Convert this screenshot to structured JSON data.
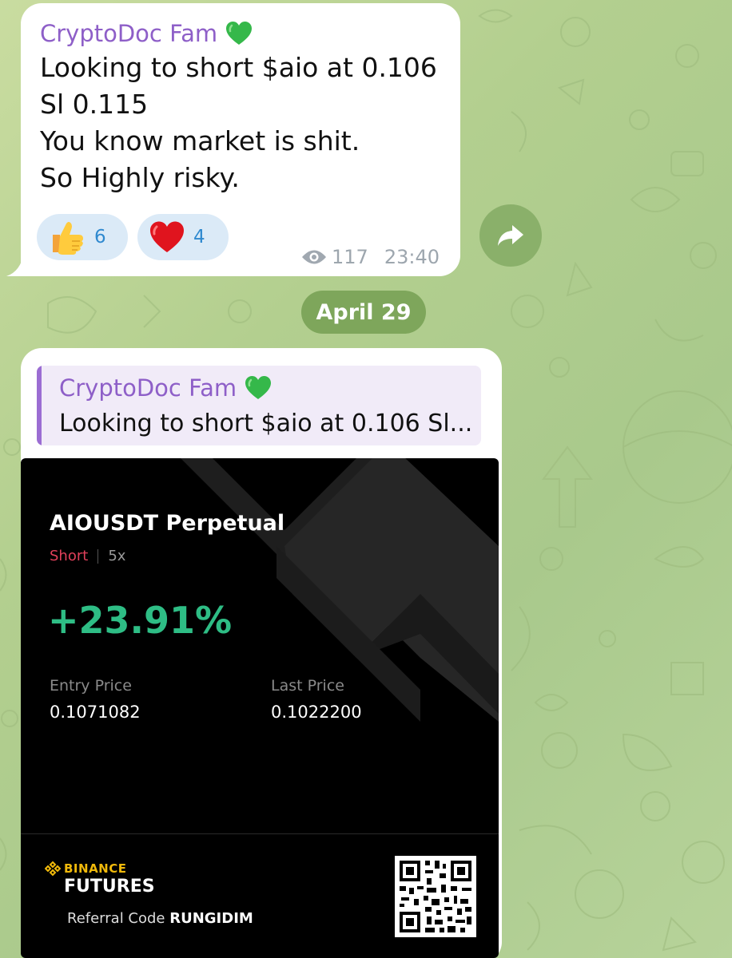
{
  "first_message": {
    "sender": "CryptoDoc Fam",
    "lines": [
      "Looking to short $aio at 0.106",
      "Sl 0.115",
      "You know market is shit.",
      "So Highly risky."
    ],
    "reactions": [
      {
        "emoji": "thumbs-up",
        "count": "6"
      },
      {
        "emoji": "red-heart",
        "count": "4"
      }
    ],
    "views": "117",
    "time": "23:40"
  },
  "date_separator": "April 29",
  "second_message": {
    "reply": {
      "sender": "CryptoDoc Fam",
      "snippet": "Looking to short $aio at 0.106 Sl..."
    },
    "card": {
      "pair": "AIOUSDT Perpetual",
      "side": "Short",
      "leverage": "5x",
      "pnl": "+23.91%",
      "entry_label": "Entry Price",
      "entry_value": "0.1071082",
      "last_label": "Last Price",
      "last_value": "0.1022200",
      "brand_top": "BINANCE",
      "brand_bottom": "FUTURES",
      "referral_label": "Referral Code",
      "referral_code": "RUNGIDIM"
    }
  },
  "colors": {
    "sender": "#8e5fc8",
    "pnl_positive": "#2ebd85",
    "short": "#e0405a",
    "binance_yellow": "#f0b90b",
    "date_pill": "#7ea65b"
  }
}
